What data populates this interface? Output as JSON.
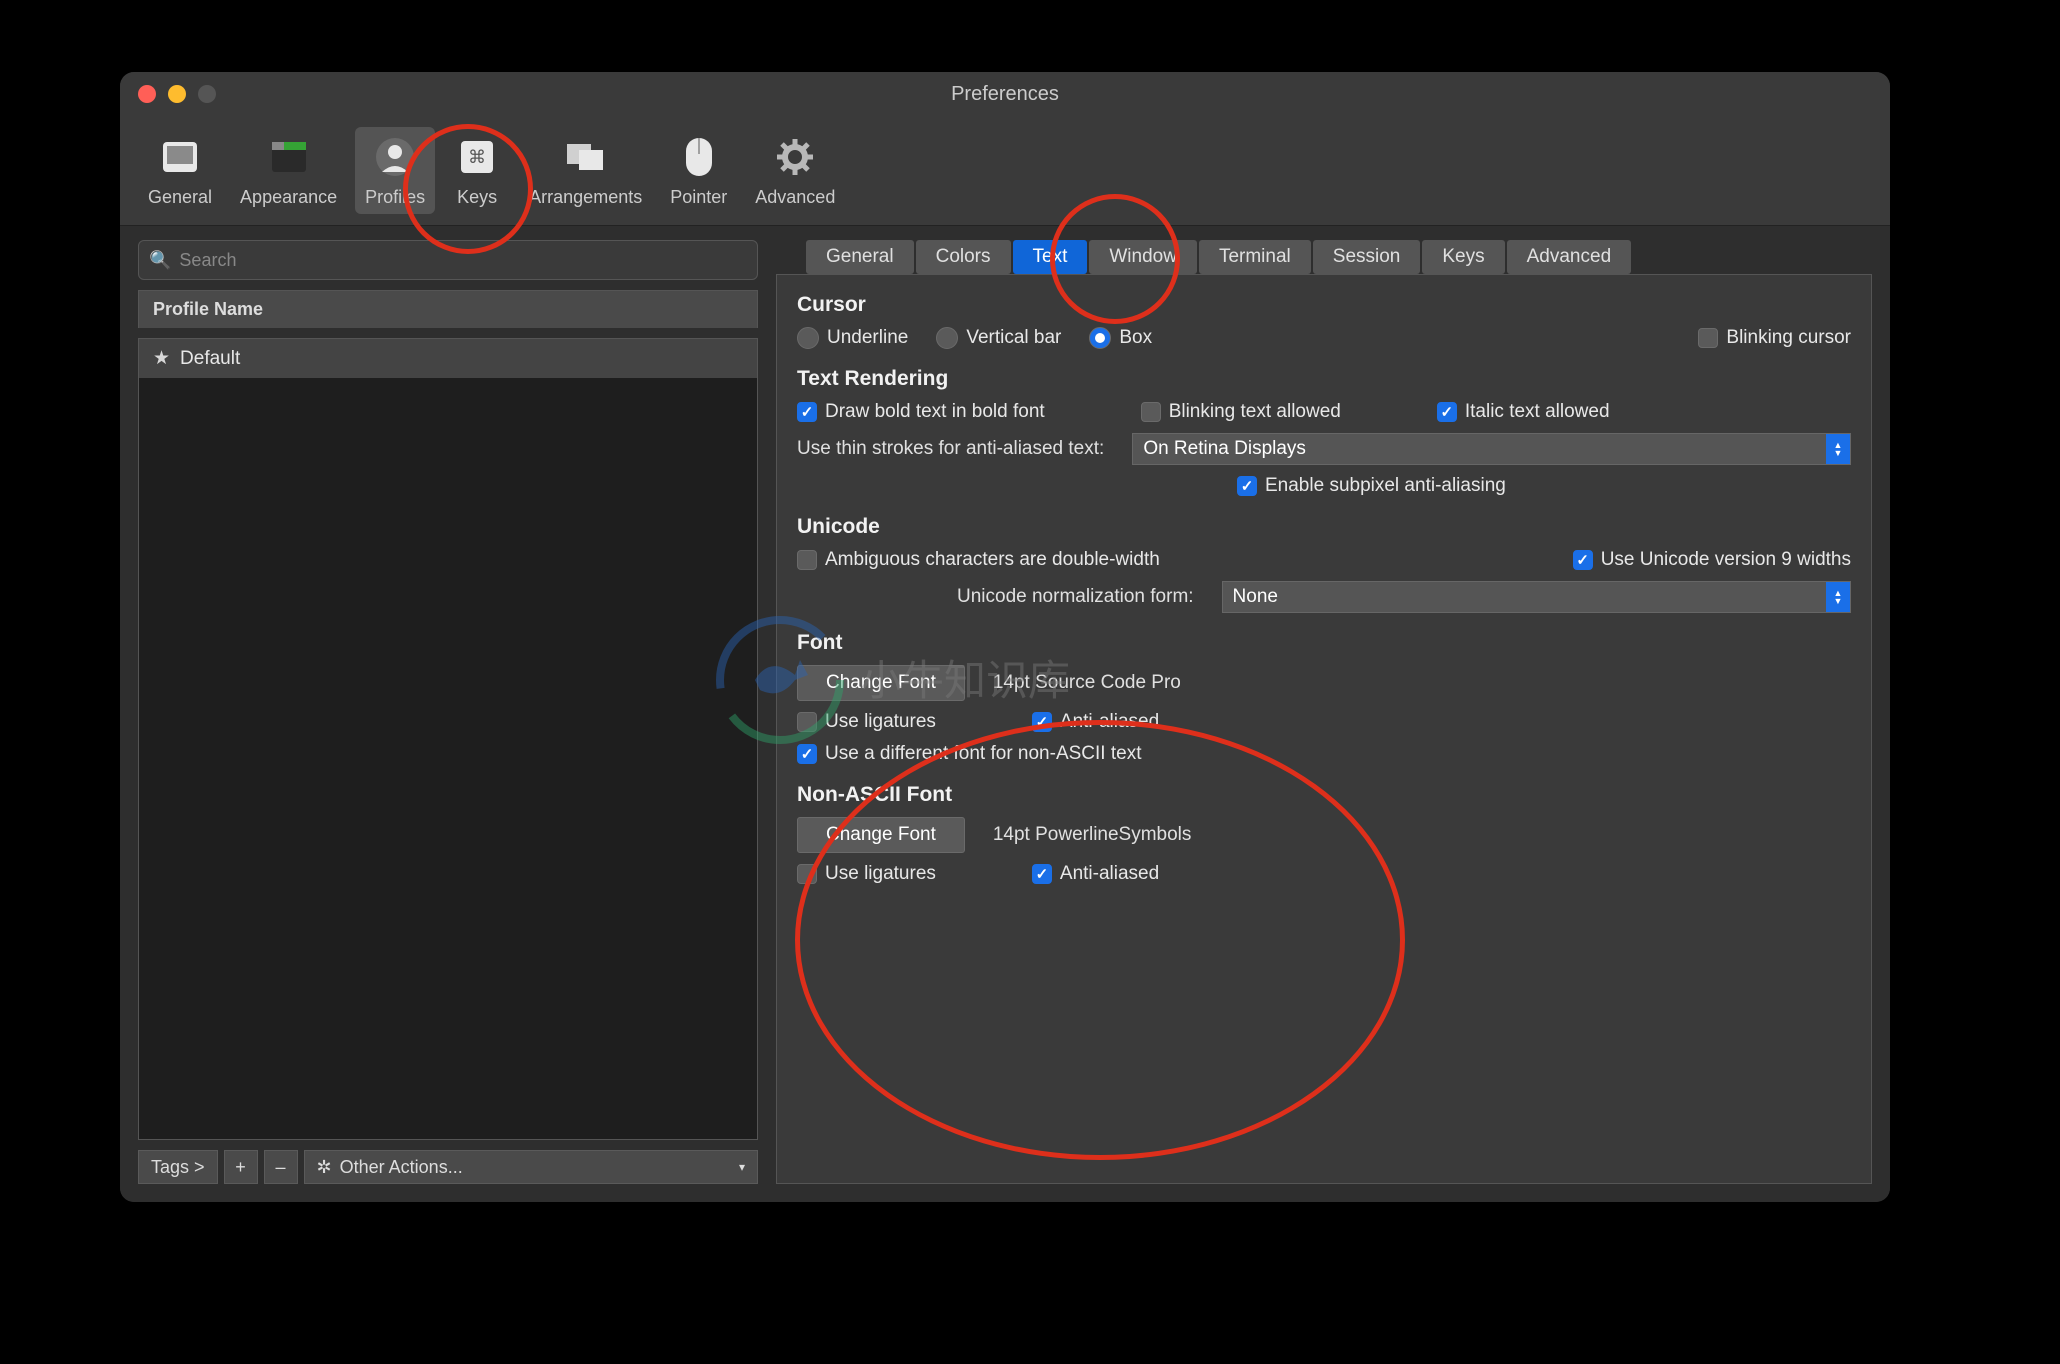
{
  "window": {
    "title": "Preferences"
  },
  "toolbar": {
    "items": [
      {
        "label": "General"
      },
      {
        "label": "Appearance"
      },
      {
        "label": "Profiles"
      },
      {
        "label": "Keys"
      },
      {
        "label": "Arrangements"
      },
      {
        "label": "Pointer"
      },
      {
        "label": "Advanced"
      }
    ]
  },
  "sidebar": {
    "search_placeholder": "Search",
    "header": "Profile Name",
    "items": [
      {
        "label": "Default"
      }
    ],
    "footer": {
      "tags": "Tags >",
      "plus": "+",
      "minus": "–",
      "actions": "Other Actions..."
    }
  },
  "tabs": [
    "General",
    "Colors",
    "Text",
    "Window",
    "Terminal",
    "Session",
    "Keys",
    "Advanced"
  ],
  "active_tab": "Text",
  "text_panel": {
    "cursor": {
      "title": "Cursor",
      "underline": "Underline",
      "vertical_bar": "Vertical bar",
      "box": "Box",
      "blinking": "Blinking cursor"
    },
    "text_rendering": {
      "title": "Text Rendering",
      "draw_bold": "Draw bold text in bold font",
      "blinking_text": "Blinking text allowed",
      "italic_text": "Italic text allowed",
      "thin_strokes_label": "Use thin strokes for anti-aliased text:",
      "thin_strokes_value": "On Retina Displays",
      "subpixel": "Enable subpixel anti-aliasing"
    },
    "unicode": {
      "title": "Unicode",
      "ambiguous": "Ambiguous characters are double-width",
      "v9": "Use Unicode version 9 widths",
      "norm_label": "Unicode normalization form:",
      "norm_value": "None"
    },
    "font": {
      "title": "Font",
      "change": "Change Font",
      "current": "14pt Source Code Pro",
      "ligatures": "Use ligatures",
      "anti_aliased": "Anti-aliased",
      "diff_non_ascii": "Use a different font for non-ASCII text"
    },
    "non_ascii_font": {
      "title": "Non-ASCII Font",
      "change": "Change Font",
      "current": "14pt PowerlineSymbols",
      "ligatures": "Use ligatures",
      "anti_aliased": "Anti-aliased"
    }
  },
  "watermark": "小牛知识库"
}
